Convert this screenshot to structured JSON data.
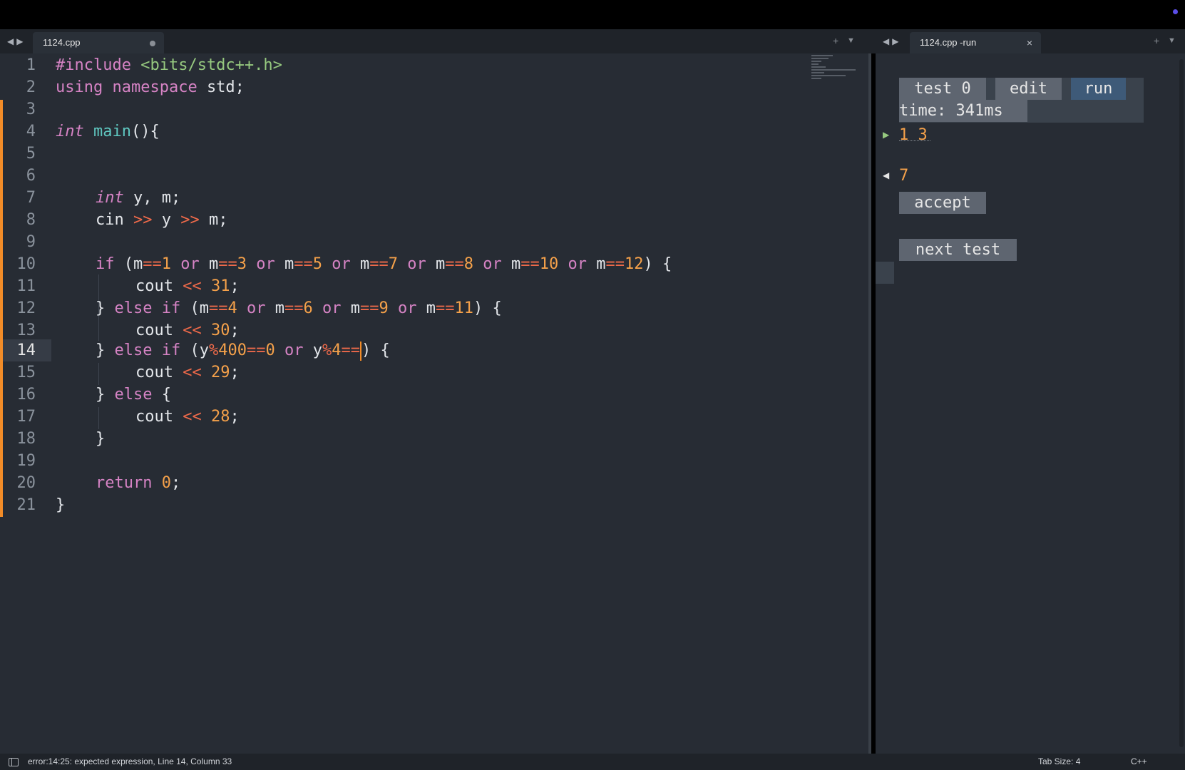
{
  "editor_tab": {
    "title": "1124.cpp"
  },
  "run_tab": {
    "title": "1124.cpp -run"
  },
  "code_lines": [
    "1",
    "2",
    "3",
    "4",
    "5",
    "6",
    "7",
    "8",
    "9",
    "10",
    "11",
    "12",
    "13",
    "14",
    "15",
    "16",
    "17",
    "18",
    "19",
    "20",
    "21"
  ],
  "active_line": "14",
  "code": {
    "l1a": "#include ",
    "l1b": "<bits/stdc++.h>",
    "l2a": "using ",
    "l2b": "namespace ",
    "l2c": "std;",
    "l4a": "int ",
    "l4b": "main",
    "l4c": "(){",
    "l7a": "int ",
    "l7b": "y, m;",
    "l8a": "cin ",
    "l8b": ">>",
    "l8c": " y ",
    "l8d": ">>",
    "l8e": " m;",
    "l10": [
      [
        "kw",
        "if"
      ],
      [
        "pl",
        " (m"
      ],
      [
        "op",
        "=="
      ],
      [
        "num",
        "1"
      ],
      [
        "pl",
        " "
      ],
      [
        "kw",
        "or"
      ],
      [
        "pl",
        " m"
      ],
      [
        "op",
        "=="
      ],
      [
        "num",
        "3"
      ],
      [
        "pl",
        " "
      ],
      [
        "kw",
        "or"
      ],
      [
        "pl",
        " m"
      ],
      [
        "op",
        "=="
      ],
      [
        "num",
        "5"
      ],
      [
        "pl",
        " "
      ],
      [
        "kw",
        "or"
      ],
      [
        "pl",
        " m"
      ],
      [
        "op",
        "=="
      ],
      [
        "num",
        "7"
      ],
      [
        "pl",
        " "
      ],
      [
        "kw",
        "or"
      ],
      [
        "pl",
        " m"
      ],
      [
        "op",
        "=="
      ],
      [
        "num",
        "8"
      ],
      [
        "pl",
        " "
      ],
      [
        "kw",
        "or"
      ],
      [
        "pl",
        " m"
      ],
      [
        "op",
        "=="
      ],
      [
        "num",
        "10"
      ],
      [
        "pl",
        " "
      ],
      [
        "kw",
        "or"
      ],
      [
        "pl",
        " m"
      ],
      [
        "op",
        "=="
      ],
      [
        "num",
        "12"
      ],
      [
        "pl",
        ") {"
      ]
    ],
    "l11": [
      [
        "pl",
        "cout "
      ],
      [
        "op",
        "<<"
      ],
      [
        "pl",
        " "
      ],
      [
        "num",
        "31"
      ],
      [
        "pl",
        ";"
      ]
    ],
    "l12": [
      [
        "pl",
        "} "
      ],
      [
        "kw",
        "else if"
      ],
      [
        "pl",
        " (m"
      ],
      [
        "op",
        "=="
      ],
      [
        "num",
        "4"
      ],
      [
        "pl",
        " "
      ],
      [
        "kw",
        "or"
      ],
      [
        "pl",
        " m"
      ],
      [
        "op",
        "=="
      ],
      [
        "num",
        "6"
      ],
      [
        "pl",
        " "
      ],
      [
        "kw",
        "or"
      ],
      [
        "pl",
        " m"
      ],
      [
        "op",
        "=="
      ],
      [
        "num",
        "9"
      ],
      [
        "pl",
        " "
      ],
      [
        "kw",
        "or"
      ],
      [
        "pl",
        " m"
      ],
      [
        "op",
        "=="
      ],
      [
        "num",
        "11"
      ],
      [
        "pl",
        ") {"
      ]
    ],
    "l13": [
      [
        "pl",
        "cout "
      ],
      [
        "op",
        "<<"
      ],
      [
        "pl",
        " "
      ],
      [
        "num",
        "30"
      ],
      [
        "pl",
        ";"
      ]
    ],
    "l14a": [
      [
        "pl",
        "} "
      ],
      [
        "kw",
        "else if"
      ],
      [
        "pl",
        " (y"
      ],
      [
        "op",
        "%"
      ],
      [
        "num",
        "400"
      ],
      [
        "op",
        "=="
      ],
      [
        "num",
        "0"
      ],
      [
        "pl",
        " "
      ],
      [
        "kw",
        "or"
      ],
      [
        "pl",
        " y"
      ],
      [
        "op",
        "%"
      ],
      [
        "num",
        "4"
      ],
      [
        "op",
        "=="
      ]
    ],
    "l14b": ") {",
    "l15": [
      [
        "pl",
        "cout "
      ],
      [
        "op",
        "<<"
      ],
      [
        "pl",
        " "
      ],
      [
        "num",
        "29"
      ],
      [
        "pl",
        ";"
      ]
    ],
    "l16": [
      [
        "pl",
        "} "
      ],
      [
        "kw",
        "else"
      ],
      [
        "pl",
        " {"
      ]
    ],
    "l17": [
      [
        "pl",
        "cout "
      ],
      [
        "op",
        "<<"
      ],
      [
        "pl",
        " "
      ],
      [
        "num",
        "28"
      ],
      [
        "pl",
        ";"
      ]
    ],
    "l18": "}",
    "l20": [
      [
        "kw",
        "return"
      ],
      [
        "pl",
        " "
      ],
      [
        "num",
        "0"
      ],
      [
        "pl",
        ";"
      ]
    ],
    "l21": "}"
  },
  "run_panel": {
    "test_label": "test 0",
    "edit_label": "edit",
    "run_label": "run",
    "time_text": "time: 341ms",
    "input_value": "1 3",
    "output_value": "7",
    "accept_label": "accept",
    "next_test_label": "next test"
  },
  "status_bar": {
    "message": "error:14:25: expected expression, Line 14, Column 33",
    "tab_size": "Tab Size: 4",
    "language": "C++"
  },
  "colors": {
    "keyword": "#d583c4",
    "function": "#5fc7c0",
    "string": "#96c97f",
    "number": "#f5a14a",
    "operator": "#ef6a4a",
    "modified_bar": "#f28c28"
  }
}
